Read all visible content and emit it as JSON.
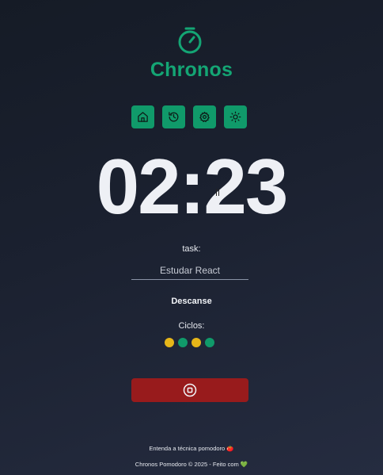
{
  "app": {
    "brand": "Chronos",
    "logo_icon": "stopwatch-icon",
    "accent_color": "#109a6a"
  },
  "menu": [
    {
      "icon": "home-icon"
    },
    {
      "icon": "history-icon"
    },
    {
      "icon": "settings-icon"
    },
    {
      "icon": "sun-icon"
    }
  ],
  "timer": {
    "display": "02:23"
  },
  "task": {
    "label": "task:",
    "value": "Estudar React"
  },
  "status": {
    "text": "Descanse"
  },
  "cycles": {
    "label": "Ciclos:",
    "dots": [
      "#e6b619",
      "#109a6a",
      "#e6b619",
      "#109a6a"
    ]
  },
  "controls": {
    "stop_icon": "stop-circle-icon",
    "stop_color": "#981b1c"
  },
  "footer": {
    "link_text": "Entenda a técnica pomodoro 🍅",
    "copyright": "Chronos Pomodoro © 2025 - Feito com 💚"
  }
}
